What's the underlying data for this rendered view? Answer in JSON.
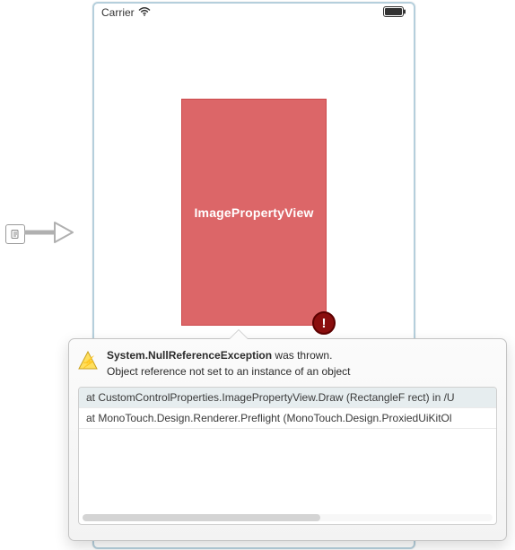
{
  "statusBar": {
    "carrier": "Carrier"
  },
  "view": {
    "label": "ImagePropertyView"
  },
  "errorBadge": {
    "mark": "!"
  },
  "popover": {
    "exceptionName": "System.NullReferenceException",
    "thrownSuffix": " was thrown.",
    "message": "Object reference not set to an instance of an object",
    "stack": [
      "at CustomControlProperties.ImagePropertyView.Draw (RectangleF rect) in /U",
      "at MonoTouch.Design.Renderer.Preflight (MonoTouch.Design.ProxiedUiKitOl"
    ]
  }
}
